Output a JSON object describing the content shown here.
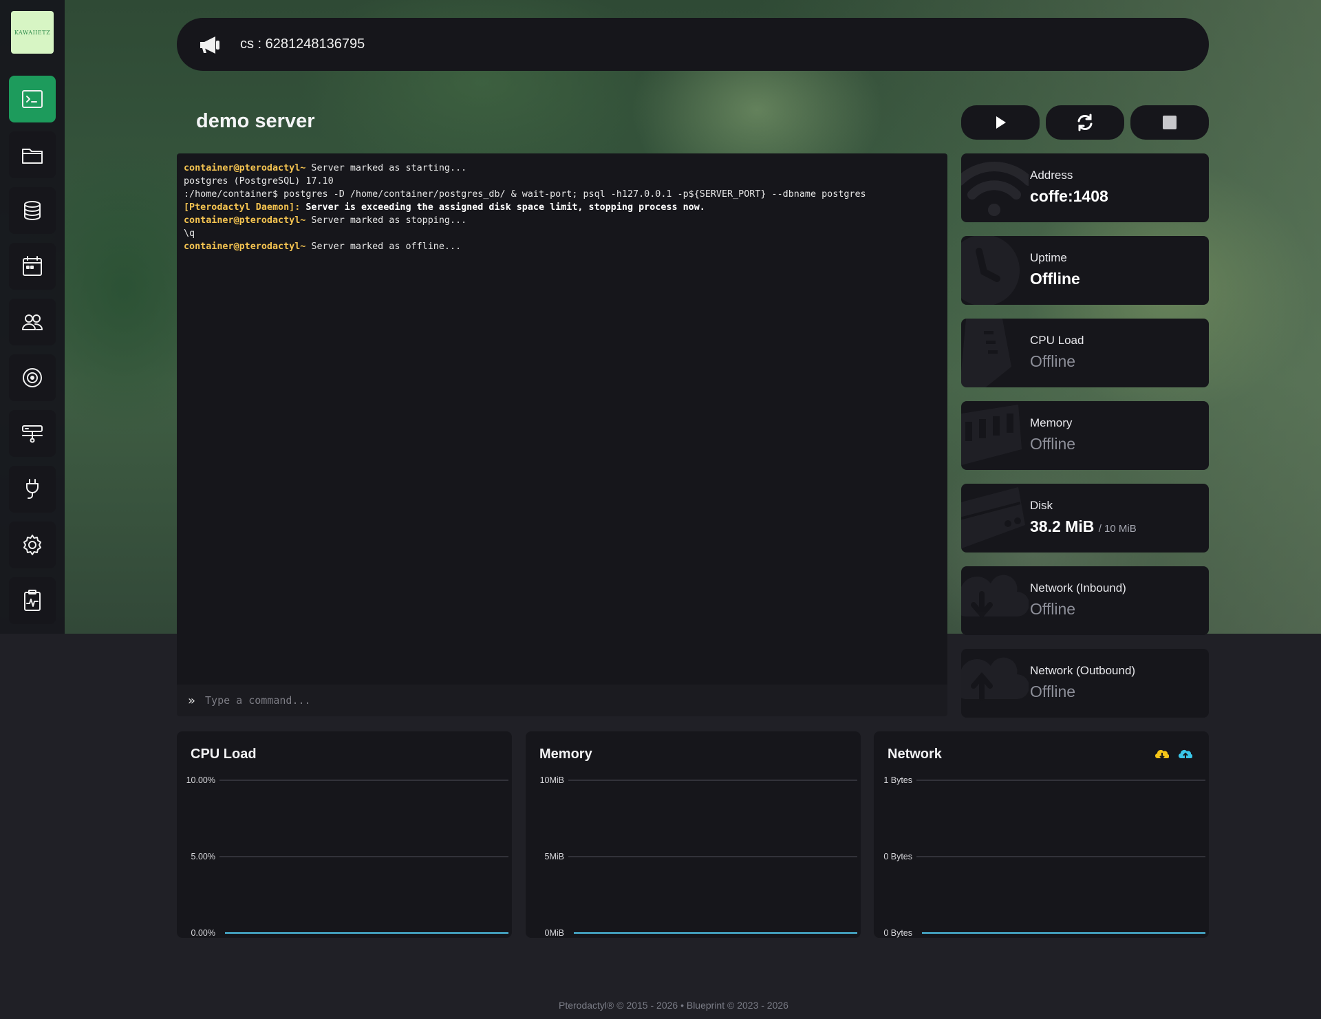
{
  "brand": {
    "logo_text": "KAWAIIETZ"
  },
  "sidebar": {
    "items": [
      {
        "label": "Console",
        "icon": "terminal-icon",
        "active": true
      },
      {
        "label": "Files",
        "icon": "folder-icon"
      },
      {
        "label": "Databases",
        "icon": "database-icon"
      },
      {
        "label": "Schedules",
        "icon": "calendar-icon"
      },
      {
        "label": "Users",
        "icon": "users-icon"
      },
      {
        "label": "Backups",
        "icon": "backup-icon"
      },
      {
        "label": "Network",
        "icon": "network-icon"
      },
      {
        "label": "Startup",
        "icon": "plug-icon"
      },
      {
        "label": "Settings",
        "icon": "gear-icon"
      },
      {
        "label": "Activity",
        "icon": "activity-icon"
      }
    ]
  },
  "announcement": {
    "icon": "megaphone-icon",
    "text": "cs : 6281248136795"
  },
  "server": {
    "name": "demo server"
  },
  "power": {
    "start": "play-icon",
    "restart": "restart-icon",
    "stop": "stop-icon"
  },
  "console": {
    "lines": [
      {
        "prefix": "container@pterodactyl~",
        "text": " Server marked as starting..."
      },
      {
        "prefix": "",
        "text": "postgres (PostgreSQL) 17.10"
      },
      {
        "prefix": "",
        "text": ":/home/container$ postgres -D /home/container/postgres_db/ & wait-port; psql -h127.0.0.1 -p${SERVER_PORT} --dbname postgres"
      },
      {
        "prefix": "[Pterodactyl Daemon]:",
        "text": " Server is exceeding the assigned disk space limit, stopping process now.",
        "bold": true
      },
      {
        "prefix": "container@pterodactyl~",
        "text": " Server marked as stopping..."
      },
      {
        "prefix": "",
        "text": "\\q"
      },
      {
        "prefix": "container@pterodactyl~",
        "text": " Server marked as offline..."
      }
    ],
    "input_placeholder": "Type a command..."
  },
  "stats": {
    "address": {
      "label": "Address",
      "value": "coffe:1408",
      "icon": "wifi-icon"
    },
    "uptime": {
      "label": "Uptime",
      "value": "Offline",
      "icon": "clock-icon"
    },
    "cpu": {
      "label": "CPU Load",
      "value": "Offline",
      "icon": "cpu-icon"
    },
    "memory": {
      "label": "Memory",
      "value": "Offline",
      "icon": "memory-icon"
    },
    "disk": {
      "label": "Disk",
      "value": "38.2 MiB",
      "limit": "/ 10 MiB",
      "icon": "disk-icon"
    },
    "net_in": {
      "label": "Network (Inbound)",
      "value": "Offline",
      "icon": "cloud-download-icon"
    },
    "net_out": {
      "label": "Network (Outbound)",
      "value": "Offline",
      "icon": "cloud-upload-icon"
    }
  },
  "colors": {
    "accent": "#1d9b5c",
    "line": "#4fc3e8",
    "prefix": "#f5c451",
    "legend_up": "#f5c518",
    "legend_down": "#3ac6e8"
  },
  "chart_data": [
    {
      "type": "line",
      "title": "CPU Load",
      "ticks": [
        "10.00%",
        "5.00%",
        "0.00%"
      ],
      "ylim": [
        0,
        10
      ],
      "series": [
        {
          "values": [
            0,
            0
          ]
        }
      ]
    },
    {
      "type": "line",
      "title": "Memory",
      "ticks": [
        "10MiB",
        "5MiB",
        "0MiB"
      ],
      "ylim": [
        0,
        10
      ],
      "series": [
        {
          "values": [
            0,
            0
          ]
        }
      ]
    },
    {
      "type": "line",
      "title": "Network",
      "ticks": [
        "1 Bytes",
        "0 Bytes",
        "0 Bytes"
      ],
      "ylim": [
        0,
        1
      ],
      "legend": [
        "cloud-download-icon",
        "cloud-upload-icon"
      ],
      "series": [
        {
          "values": [
            0,
            0
          ]
        },
        {
          "values": [
            0,
            0
          ]
        }
      ]
    }
  ],
  "footer": {
    "text": "Pterodactyl® © 2015 - 2026  •  Blueprint © 2023 - 2026"
  }
}
